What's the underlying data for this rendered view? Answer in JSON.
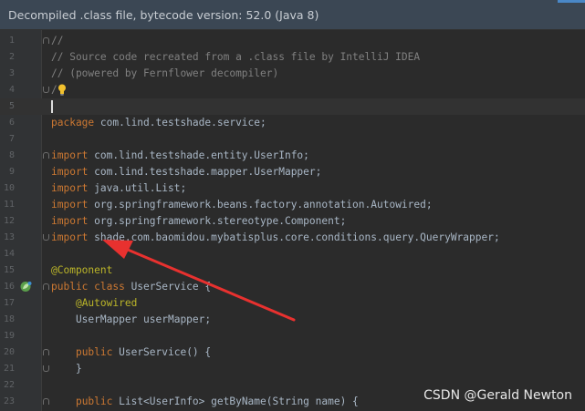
{
  "banner": {
    "text": "Decompiled .class file, bytecode version: 52.0 (Java 8)"
  },
  "lines": [
    {
      "n": "1",
      "parts": [
        [
          "cm",
          "//"
        ]
      ]
    },
    {
      "n": "2",
      "parts": [
        [
          "cm",
          "// Source code recreated from a .class file by IntelliJ IDEA"
        ]
      ]
    },
    {
      "n": "3",
      "parts": [
        [
          "cm",
          "// (powered by Fernflower decompiler)"
        ]
      ]
    },
    {
      "n": "4",
      "parts": [
        [
          "cm",
          "/"
        ]
      ]
    },
    {
      "n": "5",
      "parts": []
    },
    {
      "n": "6",
      "parts": [
        [
          "kw",
          "package"
        ],
        [
          "tx",
          " com.lind.testshade.service;"
        ]
      ]
    },
    {
      "n": "7",
      "parts": []
    },
    {
      "n": "8",
      "parts": [
        [
          "kw",
          "import"
        ],
        [
          "tx",
          " com.lind.testshade.entity.UserInfo;"
        ]
      ]
    },
    {
      "n": "9",
      "parts": [
        [
          "kw",
          "import"
        ],
        [
          "tx",
          " com.lind.testshade.mapper.UserMapper;"
        ]
      ]
    },
    {
      "n": "10",
      "parts": [
        [
          "kw",
          "import"
        ],
        [
          "tx",
          " java.util.List;"
        ]
      ]
    },
    {
      "n": "11",
      "parts": [
        [
          "kw",
          "import"
        ],
        [
          "tx",
          " org.springframework.beans.factory.annotation.Autowired;"
        ]
      ]
    },
    {
      "n": "12",
      "parts": [
        [
          "kw",
          "import"
        ],
        [
          "tx",
          " org.springframework.stereotype.Component;"
        ]
      ]
    },
    {
      "n": "13",
      "parts": [
        [
          "kw",
          "import"
        ],
        [
          "tx",
          " shade.com.baomidou.mybatisplus.core.conditions.query.QueryWrapper;"
        ]
      ]
    },
    {
      "n": "14",
      "parts": []
    },
    {
      "n": "15",
      "parts": [
        [
          "an",
          "@Component"
        ]
      ]
    },
    {
      "n": "16",
      "parts": [
        [
          "kw",
          "public class"
        ],
        [
          "tx",
          " UserService {"
        ]
      ]
    },
    {
      "n": "17",
      "parts": [
        [
          "tx",
          "    "
        ],
        [
          "an",
          "@Autowired"
        ]
      ]
    },
    {
      "n": "18",
      "parts": [
        [
          "tx",
          "    UserMapper userMapper;"
        ]
      ]
    },
    {
      "n": "19",
      "parts": []
    },
    {
      "n": "20",
      "parts": [
        [
          "tx",
          "    "
        ],
        [
          "kw",
          "public"
        ],
        [
          "tx",
          " UserService() {"
        ]
      ]
    },
    {
      "n": "21",
      "parts": [
        [
          "tx",
          "    }"
        ]
      ]
    },
    {
      "n": "22",
      "parts": []
    },
    {
      "n": "23",
      "parts": [
        [
          "tx",
          "    "
        ],
        [
          "kw",
          "public"
        ],
        [
          "tx",
          " List<UserInfo> getByName(String name) {"
        ]
      ]
    }
  ],
  "watermark": "CSDN @Gerald Newton",
  "colors": {
    "keyword": "#cc7832",
    "comment": "#808080",
    "annotation": "#bbb529",
    "text": "#a9b7c6",
    "arrow": "#e8312f"
  },
  "icons": {
    "line4": "lightbulb-icon",
    "line16": "spring-bean-icon"
  }
}
